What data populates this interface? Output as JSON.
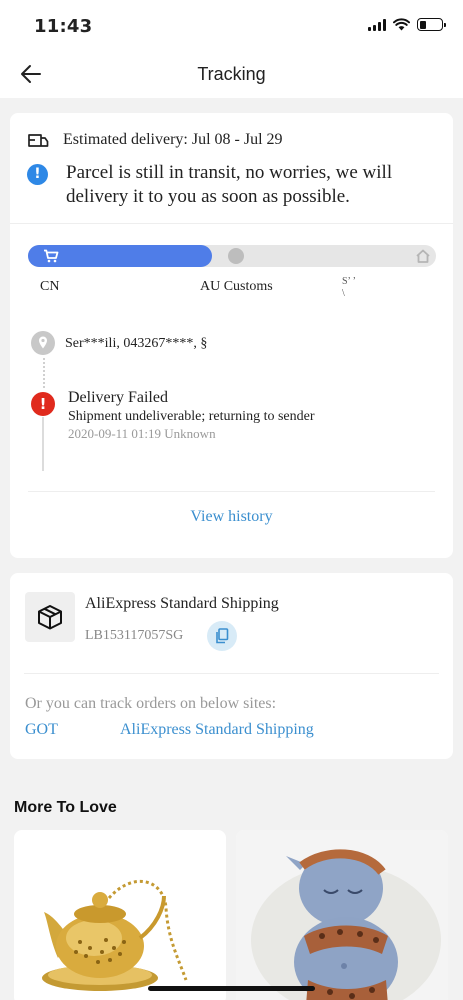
{
  "status_bar": {
    "time": "11:43"
  },
  "header": {
    "title": "Tracking"
  },
  "delivery": {
    "estimate": "Estimated delivery: Jul 08 - Jul 29",
    "notice": "Parcel is still in transit, no worries, we will delivery it to you as soon as possible."
  },
  "progress": {
    "fraction": 0.45,
    "stages": [
      "CN",
      "AU Customs",
      "S"
    ],
    "truncated_fragment": "S’ ’\n\\"
  },
  "recipient": {
    "masked": "Ser***ili,  043267****,  §"
  },
  "event": {
    "title": "Delivery Failed",
    "description": "Shipment undeliverable; returning to sender",
    "timestamp": "2020-09-11 01:19 Unknown"
  },
  "view_history_label": "View history",
  "shipping": {
    "carrier": "AliExpress Standard Shipping",
    "tracking_number": "LB153117057SG",
    "other_sites_label": "Or you can track orders on below sites:",
    "sites": [
      "GOT",
      "AliExpress Standard Shipping"
    ]
  },
  "more_to_love": {
    "title": "More To Love"
  },
  "icons": {
    "back": "back-arrow-icon",
    "truck": "truck-icon",
    "info": "info-icon",
    "cart": "cart-icon",
    "customs": "customs-icon",
    "home": "home-icon",
    "location": "location-pin-icon",
    "error": "error-icon",
    "package": "package-icon",
    "copy": "copy-icon"
  },
  "colors": {
    "accent": "#4f7de8",
    "link": "#3b8fcf",
    "error": "#e02a1d",
    "info": "#2e88e6"
  }
}
